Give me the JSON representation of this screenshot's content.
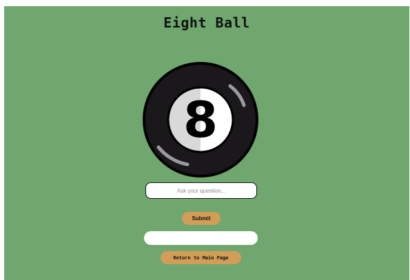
{
  "app": {
    "title": "Eight Ball"
  },
  "ball": {
    "label": "8",
    "colors": {
      "outer": "#1a181b",
      "rim": "#000000",
      "window_light": "#d9d9d9",
      "window_white": "#ffffff",
      "highlight": "#9b9b9f"
    }
  },
  "form": {
    "question_placeholder": "Ask your question...",
    "question_value": "",
    "submit_label": "Submit"
  },
  "answer": {
    "text": ""
  },
  "nav": {
    "return_label": "Return to Main Page"
  },
  "colors": {
    "background": "#6fa76f",
    "button": "#d29d57"
  }
}
